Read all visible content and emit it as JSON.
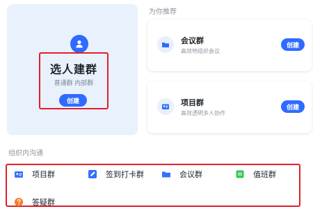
{
  "main_card": {
    "title": "选人建群",
    "subtitle": "普通群  内部群",
    "create_label": "创建"
  },
  "recommend": {
    "section_title": "为你推荐",
    "items": [
      {
        "name": "会议群",
        "desc": "高效地组织会议",
        "button": "创建",
        "icon": "folder-icon"
      },
      {
        "name": "项目群",
        "desc": "高效透明多人协作",
        "button": "创建",
        "icon": "id-card-icon"
      }
    ]
  },
  "org": {
    "section_title": "组织内沟通",
    "items": [
      {
        "label": "项目群",
        "icon": "id-card-icon",
        "color": "#3370ff"
      },
      {
        "label": "签到打卡群",
        "icon": "edit-icon",
        "color": "#3370ff"
      },
      {
        "label": "会议群",
        "icon": "folder-icon",
        "color": "#3370ff"
      },
      {
        "label": "值班群",
        "icon": "calendar-icon",
        "color": "#34c759"
      },
      {
        "label": "答疑群",
        "icon": "question-icon",
        "color": "#f57c22"
      }
    ]
  },
  "colors": {
    "accent": "#2f6bff",
    "highlight": "#e11d2a",
    "card_bg": "#e9f1fc"
  }
}
